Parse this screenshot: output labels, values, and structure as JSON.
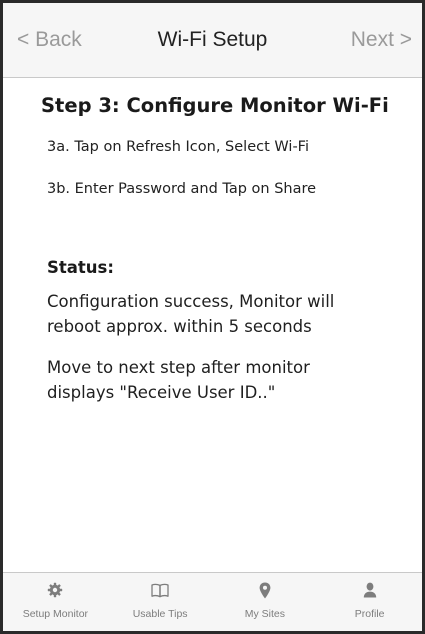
{
  "navbar": {
    "back_label": "< Back",
    "title": "Wi-Fi Setup",
    "next_label": "Next >"
  },
  "content": {
    "step_title": "Step 3: Configure Monitor Wi-Fi",
    "instructions": [
      "3a. Tap on Refresh Icon, Select Wi-Fi",
      "3b. Enter Password and Tap on Share"
    ],
    "status_label": "Status:",
    "status_message": "Configuration success, Monitor will\nreboot approx. within 5 seconds",
    "next_hint": "Move to next step after monitor\ndisplays \"Receive User ID..\""
  },
  "tabbar": {
    "tabs": [
      {
        "label": "Setup Monitor",
        "icon": "gear-icon"
      },
      {
        "label": "Usable Tips",
        "icon": "book-icon"
      },
      {
        "label": "My Sites",
        "icon": "map-pin-icon"
      },
      {
        "label": "Profile",
        "icon": "user-icon"
      }
    ]
  },
  "colors": {
    "bar_background": "#f6f6f6",
    "inactive_text": "#9a9a9a",
    "tab_icon": "#7d7d7d",
    "text": "#1a1a1a"
  }
}
